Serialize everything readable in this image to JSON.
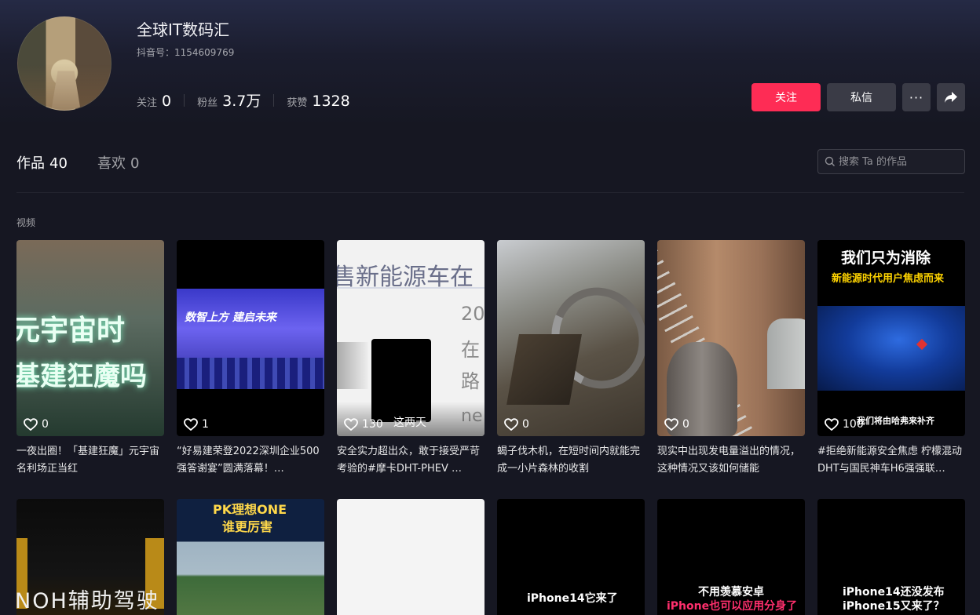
{
  "profile": {
    "name": "全球IT数码汇",
    "account": "抖音号：1154609769",
    "stats": [
      {
        "label": "关注",
        "value": "0"
      },
      {
        "label": "粉丝",
        "value": "3.7万"
      },
      {
        "label": "获赞",
        "value": "1328"
      }
    ]
  },
  "actions": {
    "follow": "关注",
    "message": "私信",
    "more": "···"
  },
  "tabs": {
    "works_label": "作品",
    "works_count": "40",
    "likes_label": "喜欢",
    "likes_count": "0"
  },
  "search": {
    "placeholder": "搜索 Ta 的作品"
  },
  "section": {
    "label": "视频"
  },
  "videos": [
    {
      "likes": "0",
      "title": "一夜出圈！「基建狂魔」元宇宙名利场正当红",
      "overlay": [
        "元宇宙时",
        "基建狂魔吗"
      ]
    },
    {
      "likes": "1",
      "title": "“好易建荣登2022深圳企业500强答谢宴”圆满落幕！…",
      "overlay": [
        "数智上方 建启未来"
      ]
    },
    {
      "likes": "130",
      "title": "安全实力超出众，敢于接受严苛考验的#摩卡DHT-PHEV …",
      "overlay": [
        "售新能源车在",
        "20",
        "在",
        "路",
        "ne"
      ],
      "extra": "这两天"
    },
    {
      "likes": "0",
      "title": "蝎子伐木机，在短时间内就能完成一小片森林的收割",
      "overlay": []
    },
    {
      "likes": "0",
      "title": "现实中出现发电量溢出的情况，这种情况又该如何储能",
      "overlay": []
    },
    {
      "likes": "100",
      "title": "#拒绝新能源安全焦虑 柠檬混动DHT与国民神车H6强强联…",
      "overlay": [
        "我们只为消除",
        "新能源时代用户焦虑而来"
      ],
      "extra": "我们将由哈弗来补齐"
    },
    {
      "overlay": [
        "NOH辅助驾驶"
      ]
    },
    {
      "overlay": [
        "PK理想ONE",
        "谁更厉害"
      ]
    },
    {
      "overlay": []
    },
    {
      "overlay": [
        "iPhone14它来了"
      ]
    },
    {
      "overlay": [
        "不用羡慕安卓",
        "iPhone也可以应用分身了"
      ]
    },
    {
      "overlay": [
        "iPhone14还没发布",
        "iPhone15又来了？"
      ]
    }
  ],
  "colors": {
    "accent": "#fe2c55",
    "background": "#161722",
    "button": "#3a3b46"
  }
}
